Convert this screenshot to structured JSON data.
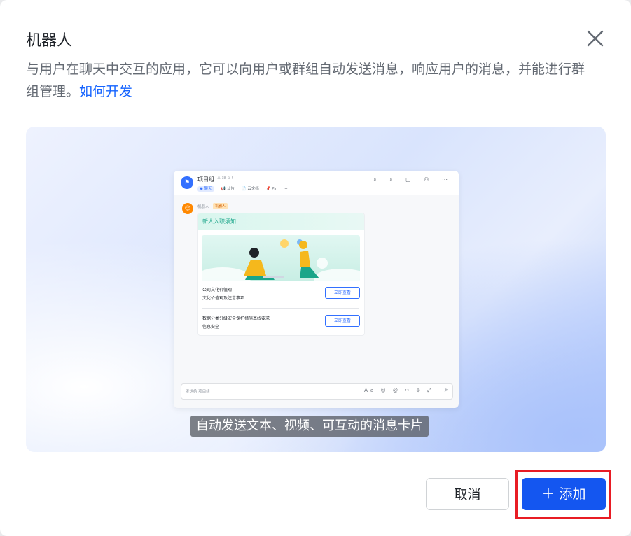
{
  "dialog": {
    "title": "机器人",
    "description": "与用户在聊天中交互的应用，它可以向用户或群组自动发送消息，响应用户的消息，并能进行群组管理。",
    "link_label": "如何开发"
  },
  "preview": {
    "caption": "自动发送文本、视频、可互动的消息卡片",
    "chat": {
      "group_name": "项目组",
      "group_meta": "⁂ 38  ⊖ !",
      "tabs": [
        "◉ 聊天",
        "📢 公告",
        "📄 云文档",
        "📌 Pin",
        "+"
      ],
      "header_icons": "⌕ ⌕ ▢ ⚇ ⋯",
      "bot_name": "机器人",
      "bot_tag": "机器人",
      "card": {
        "title": "新人入职须知",
        "rows": [
          {
            "title": "公司文化价值观",
            "subtitle": "文化价值观及注意事项",
            "button": "立即查看"
          },
          {
            "title": "数据分类分级安全保护措施基线要求",
            "subtitle": "信息安全",
            "button": "立即查看"
          }
        ]
      },
      "input_placeholder": "发送给 项目组",
      "input_icons": "Aa ☺ @ ✂ ⊕ ⤢",
      "send_icon": "➤"
    }
  },
  "footer": {
    "cancel_label": "取消",
    "add_label": "＋ 添加"
  },
  "colors": {
    "accent": "#1456f0",
    "link": "#1664ff",
    "highlight": "#e81c24"
  }
}
